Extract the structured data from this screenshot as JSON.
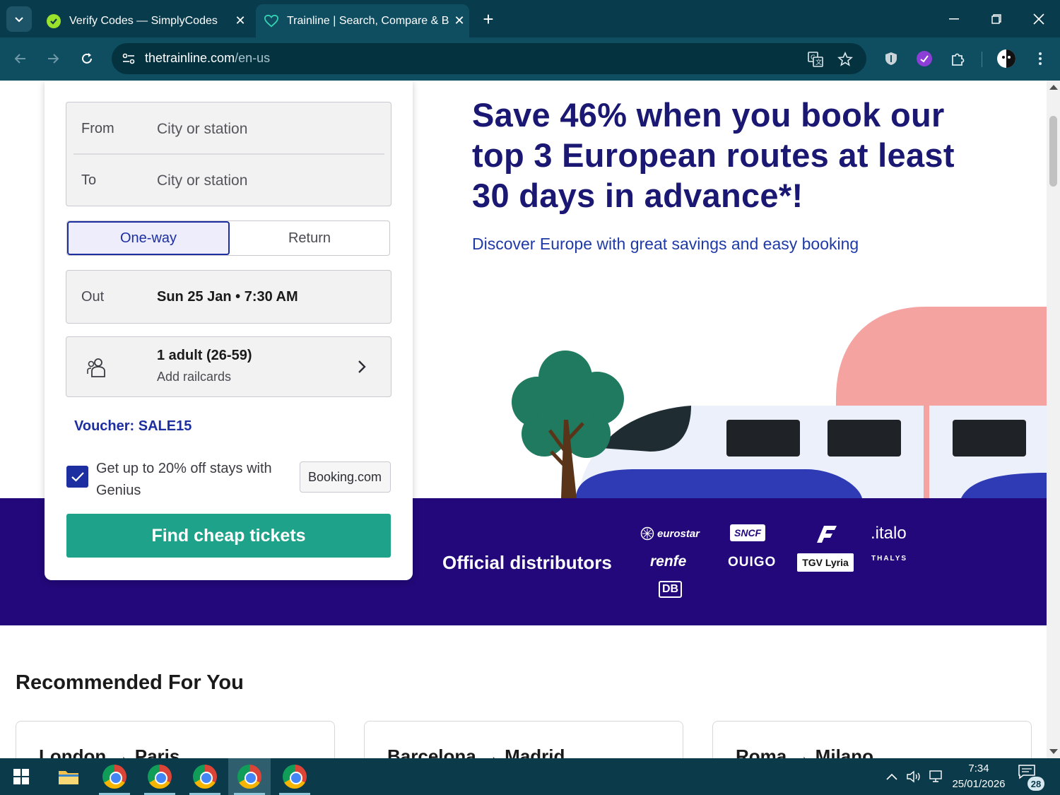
{
  "browser": {
    "tabs": [
      {
        "title": "Verify Codes — SimplyCodes",
        "active": false
      },
      {
        "title": "Trainline | Search, Compare & B",
        "active": true
      }
    ],
    "url_host": "thetrainline.com",
    "url_path": "/en-us"
  },
  "search": {
    "from_label": "From",
    "from_placeholder": "City or station",
    "to_label": "To",
    "to_placeholder": "City or station",
    "trip_types": [
      "One-way",
      "Return"
    ],
    "selected_trip_type": "One-way",
    "out_label": "Out",
    "out_value": "Sun 25 Jan • 7:30 AM",
    "passengers_value": "1 adult (26-59)",
    "railcards_label": "Add railcards",
    "voucher": "Voucher: SALE15",
    "genius_text": "Get up to 20% off stays with Genius",
    "genius_checked": true,
    "booking_badge": "Booking.com",
    "submit_label": "Find cheap tickets"
  },
  "hero": {
    "title": "Save 46% when you book our top 3 European routes at least 30 days in advance*!",
    "subtitle": "Discover Europe with great savings and easy booking"
  },
  "distributors": {
    "label": "Official distributors",
    "logos": [
      "eurostar",
      "renfe",
      "DB",
      "SNCF",
      "OUIGO",
      "TGV Lyria",
      ".italo",
      "THALYS"
    ]
  },
  "recommended": {
    "title": "Recommended For You",
    "routes": [
      "London → Paris",
      "Barcelona → Madrid",
      "Roma → Milano"
    ]
  },
  "taskbar": {
    "time": "7:34",
    "date": "25/01/2026",
    "notifications": "28"
  },
  "colors": {
    "brand_teal": "#1fa28a",
    "brand_navy": "#1a1872",
    "distributor_band": "#22087a",
    "accent_blue": "#1d2fa0"
  }
}
